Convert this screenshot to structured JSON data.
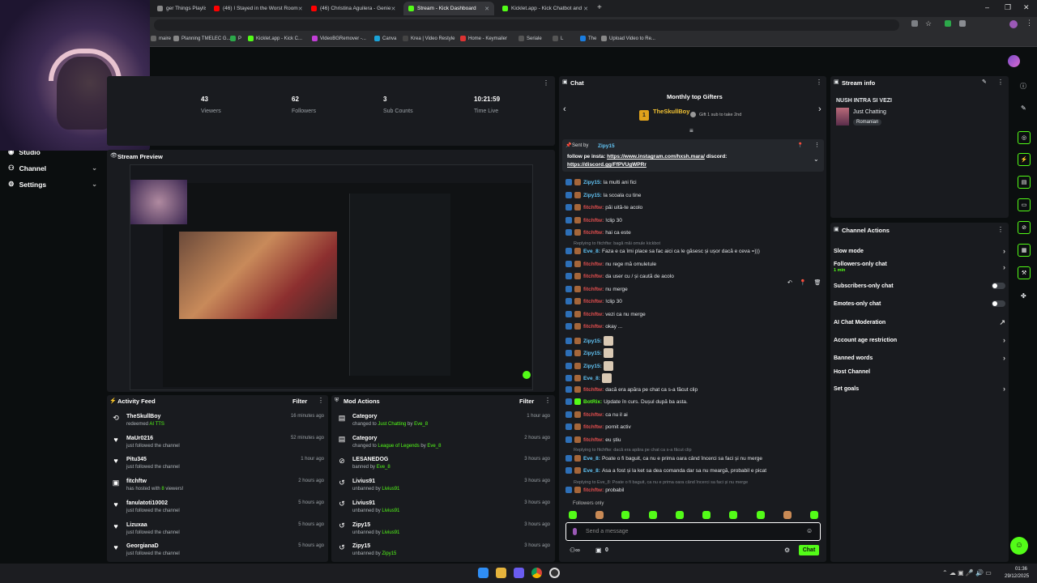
{
  "browser": {
    "tabs": [
      {
        "label": "ger Things Playlist |",
        "color": "#888"
      },
      {
        "label": "(46) I Stayed in the Worst Room",
        "color": "#ff0000"
      },
      {
        "label": "(46) Christina Aguilera - Genie",
        "color": "#ff0000"
      },
      {
        "label": "Stream - Kick Dashboard",
        "color": "#53fc18"
      },
      {
        "label": "Kicklet.app - Kick Chatbot and",
        "color": "#53fc18"
      }
    ],
    "new_tab": "+",
    "bookmarks": [
      "maire",
      "Planning TMELEC G...",
      "P",
      "Kicklet.app - Kick C...",
      "VideoBGRemover -...",
      "Canva",
      "Krea | Video Restyle",
      "Home - Keymailer",
      "Seriale",
      "L",
      "The",
      "Upload Video to Re..."
    ]
  },
  "sidebar": {
    "items": [
      {
        "label": "Studio",
        "chev": "⌄"
      },
      {
        "label": "Channel",
        "chev": "⌄"
      },
      {
        "label": "Settings",
        "chev": "⌄"
      }
    ]
  },
  "stats": [
    {
      "value": "43",
      "label": "Viewers"
    },
    {
      "value": "62",
      "label": "Followers"
    },
    {
      "value": "3",
      "label": "Sub Counts"
    },
    {
      "value": "10:21:59",
      "label": "Time Live"
    }
  ],
  "stream_preview": {
    "title": "Stream Preview"
  },
  "activity_feed": {
    "title": "Activity Feed",
    "filter": "Filter",
    "items": [
      {
        "name": "TheSkullBoy",
        "sub_a": "redeemed ",
        "sub_b": "AI TTS",
        "sub_c": "",
        "time": "16 minutes ago",
        "icon": "⟲"
      },
      {
        "name": "MaUr0216",
        "sub_a": "just followed the channel",
        "sub_b": "",
        "sub_c": "",
        "time": "52 minutes ago",
        "icon": "♥"
      },
      {
        "name": "Pitu345",
        "sub_a": "just followed the channel",
        "sub_b": "",
        "sub_c": "",
        "time": "1 hour ago",
        "icon": "♥"
      },
      {
        "name": "fitchftw",
        "sub_a": "has hosted with ",
        "sub_b": "8",
        "sub_c": " viewers!",
        "time": "2 hours ago",
        "icon": "▣"
      },
      {
        "name": "fanulatoti10002",
        "sub_a": "just followed the channel",
        "sub_b": "",
        "sub_c": "",
        "time": "5 hours ago",
        "icon": "♥"
      },
      {
        "name": "Lizuxaa",
        "sub_a": "just followed the channel",
        "sub_b": "",
        "sub_c": "",
        "time": "5 hours ago",
        "icon": "♥"
      },
      {
        "name": "GeorgianaD",
        "sub_a": "just followed the channel",
        "sub_b": "",
        "sub_c": "",
        "time": "5 hours ago",
        "icon": "♥"
      }
    ]
  },
  "mod_actions": {
    "title": "Mod Actions",
    "filter": "Filter",
    "items": [
      {
        "name": "Category",
        "sub_a": "changed to ",
        "sub_b": "Just Chatting",
        "sub_c": " by ",
        "sub_d": "Eve_8",
        "time": "1 hour ago",
        "icon": "▤"
      },
      {
        "name": "Category",
        "sub_a": "changed to ",
        "sub_b": "League of Legends",
        "sub_c": " by ",
        "sub_d": "Eve_8",
        "time": "2 hours ago",
        "icon": "▤"
      },
      {
        "name": "LESANEDOG",
        "sub_a": "banned by ",
        "sub_b": "Eve_8",
        "sub_c": "",
        "sub_d": "",
        "time": "3 hours ago",
        "icon": "⊘"
      },
      {
        "name": "Livius91",
        "sub_a": "unbanned by ",
        "sub_b": "Livius91",
        "sub_c": "",
        "sub_d": "",
        "time": "3 hours ago",
        "icon": "↺"
      },
      {
        "name": "Livius91",
        "sub_a": "unbanned by ",
        "sub_b": "Livius91",
        "sub_c": "",
        "sub_d": "",
        "time": "3 hours ago",
        "icon": "↺"
      },
      {
        "name": "Zipy15",
        "sub_a": "unbanned by ",
        "sub_b": "Livius91",
        "sub_c": "",
        "sub_d": "",
        "time": "3 hours ago",
        "icon": "↺"
      },
      {
        "name": "Zipy15",
        "sub_a": "unbanned by ",
        "sub_b": "Zipy15",
        "sub_c": "",
        "sub_d": "",
        "time": "3 hours ago",
        "icon": "↺"
      }
    ]
  },
  "chat": {
    "title": "Chat",
    "top_gifters": "Monthly top Gifters",
    "gifter_name": "TheSkullBoy",
    "gifter_rank": "1",
    "gifter_hint": "Gift 1 sub to take 2nd",
    "pinned_by": "Sent by",
    "pinned_user": "Zipy15",
    "pinned_text": "follow pe insta: ",
    "pinned_link1": "https://www.instagram.com/hxsh.mara/",
    "pinned_mid": " discord:",
    "pinned_link2": "https://discord.gg/FfPVUgWPRr",
    "lines": [
      {
        "user": "Zipy15:",
        "color": "#62c4f5",
        "msg": "la multi ani fici"
      },
      {
        "user": "Zipy15:",
        "color": "#62c4f5",
        "msg": "la scoala cu tine"
      },
      {
        "user": "fitchftw:",
        "color": "#e04e4e",
        "msg": "păi uită-te acolo"
      },
      {
        "user": "fitchftw:",
        "color": "#e04e4e",
        "msg": "!clip 30"
      },
      {
        "user": "fitchftw:",
        "color": "#e04e4e",
        "msg": "hai ca este"
      },
      {
        "user": "Eve_8:",
        "color": "#62c4f5",
        "msg": "Faza e ca îmi place sa fac aici ca le găsesc și ușor dacă e ceva =)))"
      },
      {
        "user": "fitchftw:",
        "color": "#e04e4e",
        "msg": "nu rege mă omuletule"
      },
      {
        "user": "fitchftw:",
        "color": "#e04e4e",
        "msg": "da user cu / și caută de acolo"
      },
      {
        "user": "fitchftw:",
        "color": "#e04e4e",
        "msg": "nu merge"
      },
      {
        "user": "fitchftw:",
        "color": "#e04e4e",
        "msg": "!clip 30"
      },
      {
        "user": "fitchftw:",
        "color": "#e04e4e",
        "msg": "vezi ca nu merge"
      },
      {
        "user": "fitchftw:",
        "color": "#e04e4e",
        "msg": "okay ..."
      },
      {
        "user": "Zipy15:",
        "color": "#62c4f5",
        "msg": ""
      },
      {
        "user": "Zipy15:",
        "color": "#62c4f5",
        "msg": ""
      },
      {
        "user": "Zipy15:",
        "color": "#62c4f5",
        "msg": ""
      },
      {
        "user": "Eve_8:",
        "color": "#62c4f5",
        "msg": ""
      },
      {
        "user": "fitchftw:",
        "color": "#e04e4e",
        "msg": "dacă era apăra pe chat ca s-a făcut clip"
      },
      {
        "user": "BotRix:",
        "color": "#53fc18",
        "msg": "Update în curs. Dușul după ba asta."
      },
      {
        "user": "fitchftw:",
        "color": "#e04e4e",
        "msg": "ca nu il ai"
      },
      {
        "user": "fitchftw:",
        "color": "#e04e4e",
        "msg": "pornit activ"
      },
      {
        "user": "fitchftw:",
        "color": "#e04e4e",
        "msg": "eu știu"
      },
      {
        "user": "Eve_8:",
        "color": "#62c4f5",
        "msg": "Poate o fi baguit, ca nu e prima oara când încerci sa faci și nu merge"
      },
      {
        "user": "Eve_8:",
        "color": "#62c4f5",
        "msg": "Asa a fost și la ket sa dea comanda dar sa nu meargă, probabil e picat"
      },
      {
        "user": "fitchftw:",
        "color": "#e04e4e",
        "msg": "probabil"
      }
    ],
    "reply_1": "Replying to fitchftw: bagă măi omule kickbot",
    "reply_2": "Replying to fitchftw: dacă era apăra pe chat ca s-a făcut clip",
    "reply_3": "Replying to Eve_8: Poate o fi baguit, ca nu e prima oara când încerci sa faci și nu merge",
    "followers_only": "Followers only",
    "input_placeholder": "Send a message",
    "points": "0",
    "send": "Chat"
  },
  "stream_info": {
    "title": "Stream info",
    "stream_title": "NUSH INTRA SI VEZI",
    "category": "Just Chatting",
    "tag": "Romanian"
  },
  "channel_actions": {
    "title": "Channel Actions",
    "items": [
      {
        "label": "Slow mode",
        "kind": "chev",
        "sub": ""
      },
      {
        "label": "Followers-only chat",
        "kind": "chev",
        "sub": "1 min"
      },
      {
        "label": "Subscribers-only chat",
        "kind": "toggle",
        "sub": ""
      },
      {
        "label": "Emotes-only chat",
        "kind": "toggle",
        "sub": ""
      },
      {
        "label": "AI Chat Moderation",
        "kind": "ext",
        "sub": ""
      },
      {
        "label": "Account age restriction",
        "kind": "chev",
        "sub": ""
      },
      {
        "label": "Banned words",
        "kind": "chev",
        "sub": ""
      },
      {
        "label": "Host Channel",
        "kind": "none",
        "sub": ""
      },
      {
        "label": "Set goals",
        "kind": "chev",
        "sub": ""
      }
    ]
  },
  "taskbar": {
    "time": "01:36",
    "date": "29/12/2025"
  },
  "colors": {
    "accent": "#53fc18",
    "panel": "#191b1f",
    "bg": "#0b0e0f"
  }
}
